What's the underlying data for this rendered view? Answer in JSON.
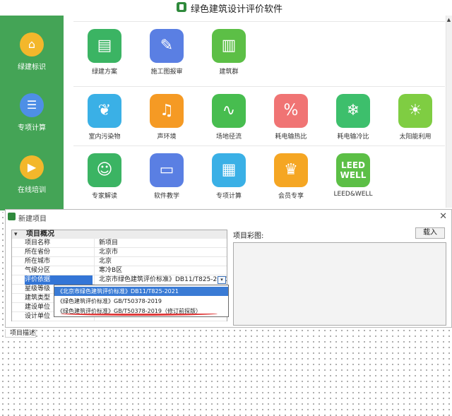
{
  "app": {
    "title": "绿色建筑设计评价软件"
  },
  "sidebar": {
    "items": [
      {
        "label": "绿建标识",
        "icon": "building-leaf-icon",
        "color": "#f3b72b"
      },
      {
        "label": "专项计算",
        "icon": "document-list-icon",
        "color": "#4e8fe6"
      },
      {
        "label": "在线培训",
        "icon": "play-video-icon",
        "color": "#f3b72b"
      }
    ]
  },
  "rows": [
    {
      "tiles": [
        {
          "label": "绿建方案",
          "icon": "document-icon",
          "color": "#3bb463"
        },
        {
          "label": "施工图报审",
          "icon": "stamp-icon",
          "color": "#5a7fe3"
        },
        {
          "label": "建筑群",
          "icon": "buildings-icon",
          "color": "#5cbf46"
        }
      ]
    },
    {
      "tiles": [
        {
          "label": "室内污染物",
          "icon": "leaves-icon",
          "color": "#3ab0e6"
        },
        {
          "label": "声环境",
          "icon": "sound-wave-icon",
          "color": "#f59a24"
        },
        {
          "label": "场地径流",
          "icon": "road-icon",
          "color": "#47bd4f"
        },
        {
          "label": "耗电输热比",
          "icon": "flame-icon",
          "color": "#f07474"
        },
        {
          "label": "耗电输冷比",
          "icon": "snowflake-icon",
          "color": "#3dbf6c"
        },
        {
          "label": "太阳能利用",
          "icon": "solar-panel-icon",
          "color": "#7fcd42"
        }
      ]
    },
    {
      "tiles": [
        {
          "label": "专家解读",
          "icon": "expert-icon",
          "color": "#3bb463"
        },
        {
          "label": "软件教学",
          "icon": "board-icon",
          "color": "#5a7fe3"
        },
        {
          "label": "专项计算",
          "icon": "calculator-icon",
          "color": "#3ab0e6"
        },
        {
          "label": "会员专享",
          "icon": "crown-icon",
          "color": "#f5a623"
        },
        {
          "label": "LEED&WELL",
          "icon": "leed-well-logo",
          "color": "#5cbf46",
          "text": "LEED WELL"
        }
      ]
    }
  ],
  "dialog": {
    "title": "新建项目",
    "group": "项目概况",
    "props": [
      {
        "key": "项目名称",
        "value": "新项目"
      },
      {
        "key": "所在省份",
        "value": "北京市"
      },
      {
        "key": "所在城市",
        "value": "北京"
      },
      {
        "key": "气候分区",
        "value": "寒冷B区"
      },
      {
        "key": "评价依据",
        "value": "北京市绿色建筑评价标准》DB11/T825-2021"
      },
      {
        "key": "星级等级",
        "value": ""
      },
      {
        "key": "建筑类型",
        "value": ""
      },
      {
        "key": "建设单位",
        "value": ""
      },
      {
        "key": "设计单位",
        "value": ""
      }
    ],
    "options": [
      "《北京市绿色建筑评价标准》DB11/T825-2021",
      "《绿色建筑评价标准》GB/T50378-2019",
      "《绿色建筑评价标准》GB/T50378-2019（修订前探版）"
    ],
    "image_label": "项目彩图:",
    "load_button": "载入",
    "desc_label": "项目描述",
    "close_glyph": "✕",
    "collapse_glyph": "▾",
    "dropdown_glyph": "▾"
  },
  "colors": {
    "sidebar": "#44a456",
    "selection": "#3a7bd5",
    "annotation": "#e03a3a"
  }
}
